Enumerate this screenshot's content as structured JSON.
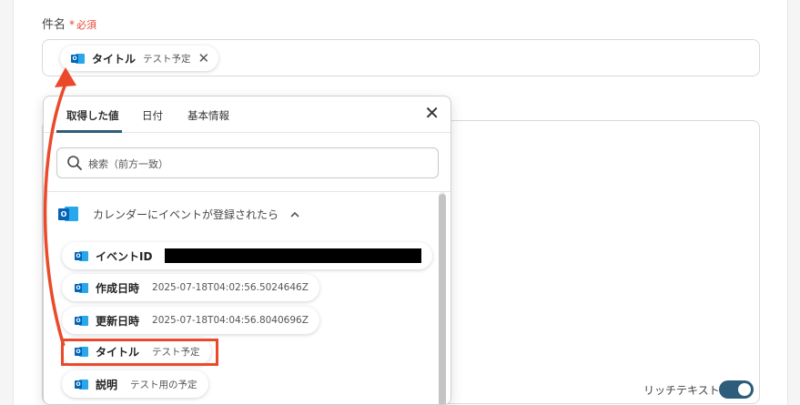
{
  "form": {
    "field_label": "件名",
    "required_mark": "*",
    "required_text": "必須",
    "subject_chip": {
      "name": "タイトル",
      "value": "テスト予定",
      "close": "✕"
    },
    "rich_text_label": "リッチテキスト",
    "rich_text_enabled": true
  },
  "popup": {
    "tabs": [
      {
        "label": "取得した値",
        "active": true
      },
      {
        "label": "日付",
        "active": false
      },
      {
        "label": "基本情報",
        "active": false
      }
    ],
    "close": "✕",
    "search_placeholder": "検索（前方一致）",
    "section_title": "カレンダーにイベントが登録されたら",
    "items": [
      {
        "label": "イベントID",
        "value": "",
        "redacted": true
      },
      {
        "label": "作成日時",
        "value": "2025-07-18T04:02:56.5024646Z"
      },
      {
        "label": "更新日時",
        "value": "2025-07-18T04:04:56.8040696Z"
      },
      {
        "label": "タイトル",
        "value": "テスト予定",
        "highlighted": true
      },
      {
        "label": "説明",
        "value": "テスト用の予定"
      }
    ]
  },
  "colors": {
    "accent": "#2d5d7a",
    "required": "#e5483a",
    "annotation": "#ea4a2a",
    "outlook_dark": "#0364b8",
    "outlook_light": "#28a8ea"
  },
  "icons": {
    "app": "outlook-icon",
    "search": "search-icon",
    "collapse": "chevron-up-icon",
    "close": "close-icon"
  }
}
